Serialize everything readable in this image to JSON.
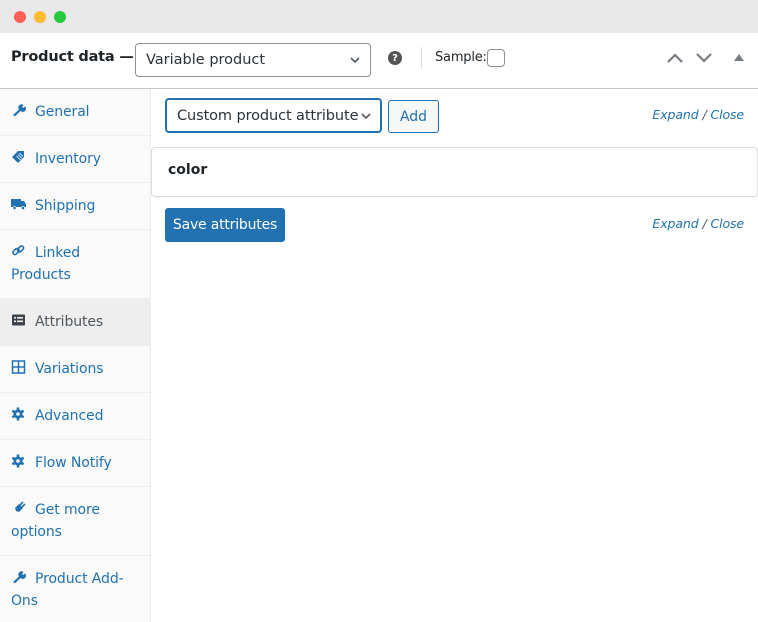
{
  "window": {
    "controls": [
      "close",
      "minimize",
      "maximize"
    ]
  },
  "header": {
    "title": "Product data —",
    "product_type": "Variable product",
    "help_icon": "question-circle-icon",
    "sample_label": "Sample:",
    "sample_checked": false,
    "controls": [
      "move-up",
      "move-down",
      "toggle-panel"
    ]
  },
  "sidebar": {
    "items": [
      {
        "label": "General",
        "icon": "wrench-icon",
        "active": false
      },
      {
        "label": "Inventory",
        "icon": "tag-icon",
        "active": false
      },
      {
        "label": "Shipping",
        "icon": "truck-icon",
        "active": false
      },
      {
        "label": "Linked Products",
        "icon": "link-icon",
        "active": false
      },
      {
        "label": "Attributes",
        "icon": "list-view-icon",
        "active": true
      },
      {
        "label": "Variations",
        "icon": "grid-icon",
        "active": false
      },
      {
        "label": "Advanced",
        "icon": "gear-icon",
        "active": false
      },
      {
        "label": "Flow Notify",
        "icon": "gear-icon",
        "active": false
      },
      {
        "label": "Get more options",
        "icon": "plug-icon",
        "active": false
      },
      {
        "label": "Product Add-Ons",
        "icon": "wrench-icon",
        "active": false
      }
    ]
  },
  "main": {
    "attribute_select": "Custom product attribute",
    "add_label": "Add",
    "expand_label": "Expand",
    "separator": "/",
    "close_label": "Close",
    "attributes": [
      {
        "name": "color"
      }
    ],
    "save_label": "Save attributes"
  },
  "colors": {
    "accent": "#2271b1",
    "sidebar_bg": "#fafafa",
    "active_tab_bg": "#eeeeee"
  }
}
